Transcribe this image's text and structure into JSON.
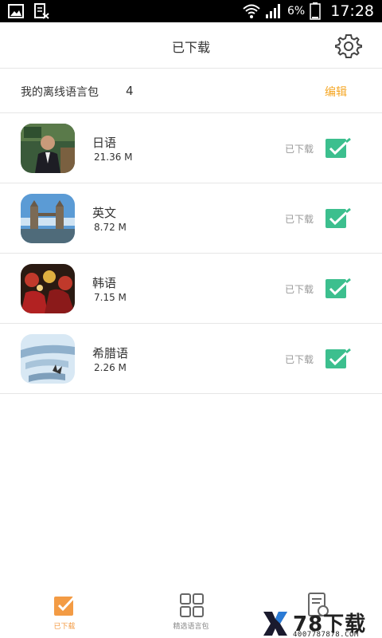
{
  "status_bar": {
    "battery_percent": "6%",
    "time": "17:28"
  },
  "header": {
    "title": "已下载"
  },
  "summary": {
    "label": "我的离线语言包",
    "count": "4",
    "edit_label": "编辑"
  },
  "packs": [
    {
      "name": "日语",
      "size": "21.36 M",
      "status": "已下载",
      "checked": true
    },
    {
      "name": "英文",
      "size": "8.72 M",
      "status": "已下载",
      "checked": true
    },
    {
      "name": "韩语",
      "size": "7.15 M",
      "status": "已下载",
      "checked": true
    },
    {
      "name": "希腊语",
      "size": "2.26 M",
      "status": "已下载",
      "checked": true
    }
  ],
  "bottom_nav": {
    "items": [
      {
        "label": "已下载",
        "active": true
      },
      {
        "label": "精选语言包",
        "active": false
      },
      {
        "label": "",
        "active": false
      }
    ]
  },
  "watermark": {
    "brand": "78下载",
    "phone": "4007787878.COM"
  },
  "colors": {
    "accent_orange": "#f39b44",
    "edit_orange": "#f5a623",
    "check_green": "#3cbf8e"
  }
}
